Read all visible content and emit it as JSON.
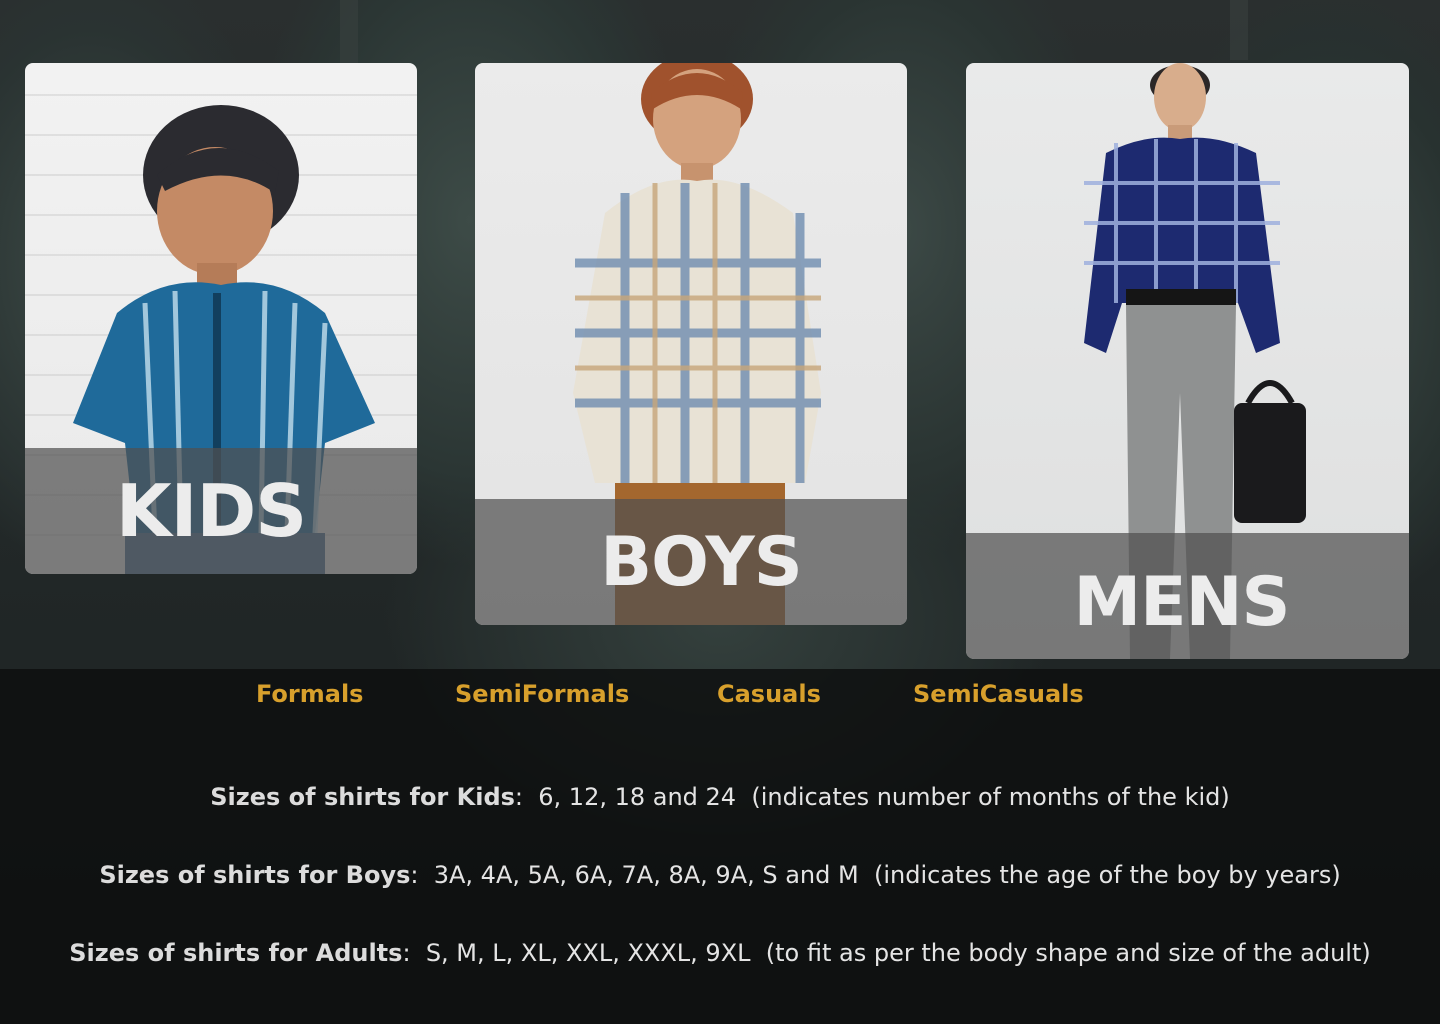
{
  "cards": [
    {
      "id": "kids",
      "label": "KIDS"
    },
    {
      "id": "boys",
      "label": "BOYS"
    },
    {
      "id": "mens",
      "label": "MENS"
    }
  ],
  "categories": [
    "Formals",
    "SemiFormals",
    "Casuals",
    "SemiCasuals"
  ],
  "sizes": [
    {
      "title": "Sizes of shirts for Kids",
      "separator": ":",
      "values": "6, 12, 18 and 24",
      "note": "(indicates number of months of the kid)"
    },
    {
      "title": "Sizes of shirts for Boys",
      "separator": ":",
      "values": "3A, 4A, 5A, 6A, 7A, 8A, 9A, S and M",
      "note": "(indicates the age of the boy by years)"
    },
    {
      "title": "Sizes of shirts for Adults",
      "separator": ":",
      "values": "S, M, L, XL, XXL, XXXL, 9XL",
      "note": "(to fit as per the body shape and size of the adult)"
    }
  ],
  "colors": {
    "accent": "#d8a02c",
    "text": "#e4e4e4",
    "band": "#505050"
  }
}
